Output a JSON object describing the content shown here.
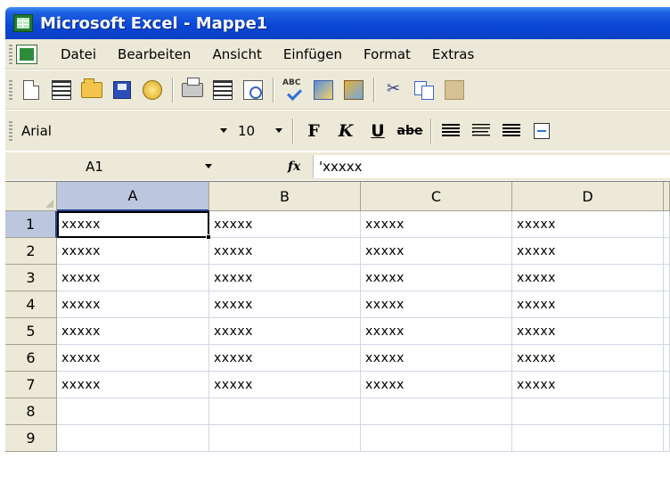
{
  "window": {
    "title": "Microsoft Excel - Mappe1"
  },
  "menubar": {
    "items": [
      "Datei",
      "Bearbeiten",
      "Ansicht",
      "Einfügen",
      "Format",
      "Extras"
    ]
  },
  "toolbar_standard": {
    "icons": [
      "new-document-icon",
      "template-icon",
      "open-folder-icon",
      "save-disk-icon",
      "permission-icon",
      "print-icon",
      "research-book-icon",
      "print-preview-icon",
      "spelling-icon",
      "research-icon",
      "research-translate-icon",
      "cut-icon",
      "copy-icon",
      "paste-icon"
    ]
  },
  "toolbar_formatting": {
    "font": "Arial",
    "font_size": "10",
    "bold_label": "F",
    "italic_label": "K",
    "underline_label": "U",
    "strike_label": "abe",
    "icons": [
      "align-left-icon",
      "align-center-icon",
      "align-right-icon",
      "merge-center-icon"
    ]
  },
  "formula_bar": {
    "name_box": "A1",
    "fx_label": "fx",
    "formula": "'xxxxx"
  },
  "sheet": {
    "columns": [
      "A",
      "B",
      "C",
      "D"
    ],
    "selected_column": "A",
    "rows": [
      "1",
      "2",
      "3",
      "4",
      "5",
      "6",
      "7",
      "8",
      "9"
    ],
    "selected_row": "1",
    "active_cell": "A1",
    "cells": [
      [
        "xxxxx",
        "xxxxx",
        "xxxxx",
        "xxxxx"
      ],
      [
        "xxxxx",
        "xxxxx",
        "xxxxx",
        "xxxxx"
      ],
      [
        "xxxxx",
        "xxxxx",
        "xxxxx",
        "xxxxx"
      ],
      [
        "xxxxx",
        "xxxxx",
        "xxxxx",
        "xxxxx"
      ],
      [
        "xxxxx",
        "xxxxx",
        "xxxxx",
        "xxxxx"
      ],
      [
        "xxxxx",
        "xxxxx",
        "xxxxx",
        "xxxxx"
      ],
      [
        "xxxxx",
        "xxxxx",
        "xxxxx",
        "xxxxx"
      ],
      [
        "",
        "",
        "",
        ""
      ],
      [
        "",
        "",
        "",
        ""
      ]
    ]
  },
  "colors": {
    "titlebar": "#0a46d6",
    "chrome": "#ece9d8",
    "header_selected": "#bcc7df",
    "gridline": "#d0d7e5"
  }
}
